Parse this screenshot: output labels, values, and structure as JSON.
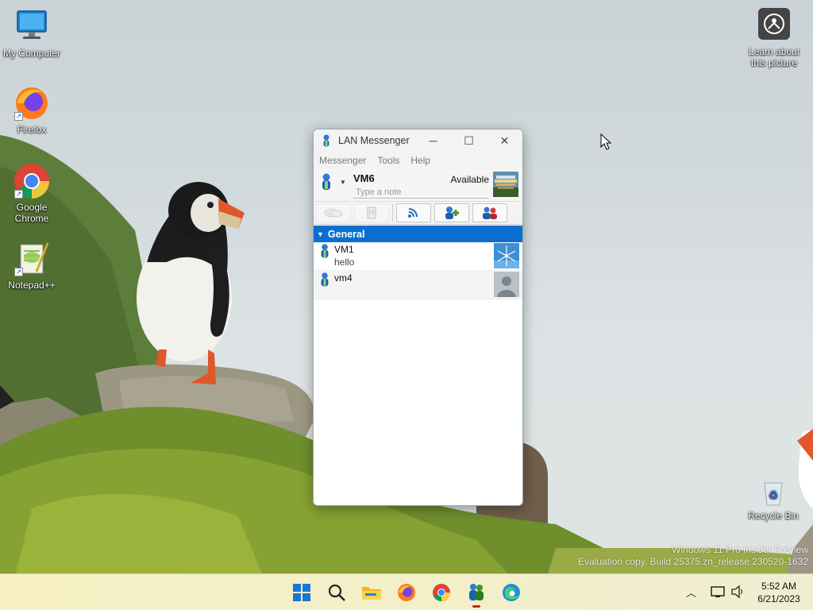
{
  "desktop": {
    "icons": [
      {
        "label": "My Computer",
        "icon": "monitor-icon"
      },
      {
        "label": "Firefox",
        "icon": "firefox-icon"
      },
      {
        "label": "Google Chrome",
        "icon": "chrome-icon"
      },
      {
        "label": "Notepad++",
        "icon": "notepadpp-icon"
      }
    ],
    "learn_about": "Learn about this picture",
    "recycle_bin": "Recycle Bin",
    "watermark_line1": "Windows 11 Pro Insider Preview",
    "watermark_line2": "Evaluation copy. Build 25375.zn_release.230520-1632"
  },
  "messenger": {
    "title": "LAN Messenger",
    "menu": [
      "Messenger",
      "Tools",
      "Help"
    ],
    "my_name": "VM6",
    "availability": "Available",
    "note_placeholder": "Type a note",
    "toolbar": [
      "chat",
      "file-transfer",
      "broadcast",
      "add-contact",
      "group"
    ],
    "group_name": "General",
    "contacts": [
      {
        "name": "VM1",
        "note": "hello",
        "avatar": "windmill-avatar"
      },
      {
        "name": "vm4",
        "note": "",
        "avatar": "silhouette-avatar"
      }
    ],
    "colors": {
      "group_header": "#0a6fd0"
    }
  },
  "taskbar": {
    "apps": [
      "start",
      "search",
      "file-explorer",
      "firefox",
      "chrome",
      "lan-messenger",
      "edge"
    ],
    "time": "5:52 AM",
    "date": "6/21/2023"
  }
}
